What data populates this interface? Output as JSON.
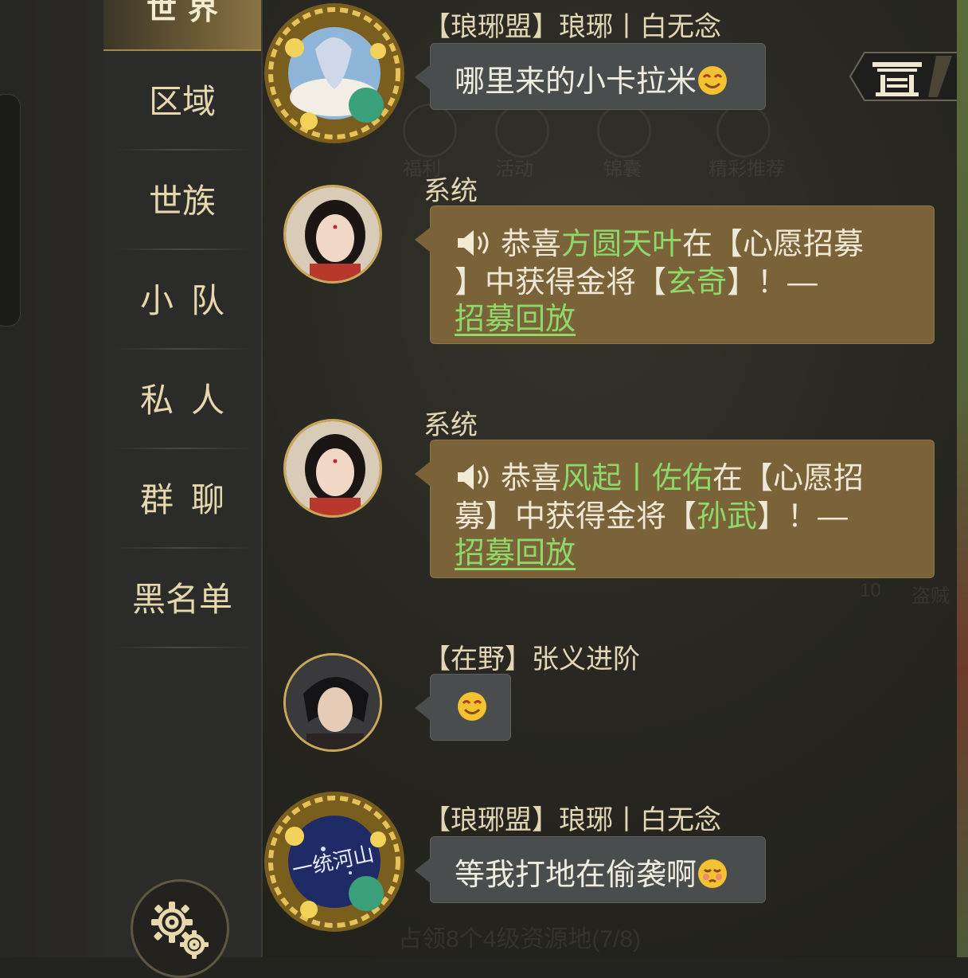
{
  "sidebar": {
    "active_tab": "世界",
    "tabs": [
      "区域",
      "世族",
      "小队",
      "私人",
      "群聊",
      "黑名单"
    ],
    "settings_icon": "gear-icon"
  },
  "background_labels": [
    "福利",
    "活动",
    "锦囊",
    "精彩推荐",
    "占领8个4级资源地(7/8)",
    "10",
    "盗贼"
  ],
  "messages": [
    {
      "sender": "【琅琊盟】琅琊丨白无念",
      "text": "哪里来的小卡拉米",
      "emoji": "smile-emoji",
      "type": "player"
    },
    {
      "sender": "系统",
      "type": "system",
      "parts": {
        "prefix": "恭喜",
        "player": "方圆天叶",
        "mid": "在【心愿招募",
        "line2a": "】中获得金将【",
        "general": "玄奇",
        "line2b": "】！—",
        "link": "招募回放"
      }
    },
    {
      "sender": "系统",
      "type": "system",
      "parts": {
        "prefix": "恭喜",
        "player": "风起丨佐佑",
        "mid": "在【心愿招",
        "line2a": "募】中获得金将【",
        "general": "孙武",
        "line2b": "】！—",
        "link": "招募回放"
      }
    },
    {
      "sender": "【在野】张义进阶",
      "text": "",
      "emoji": "smile-emoji",
      "type": "player"
    },
    {
      "sender": "【琅琊盟】琅琊丨白无念",
      "text": "等我打地在偷袭啊",
      "emoji": "shy-emoji",
      "type": "player",
      "avatar_text": "一统河山"
    }
  ]
}
